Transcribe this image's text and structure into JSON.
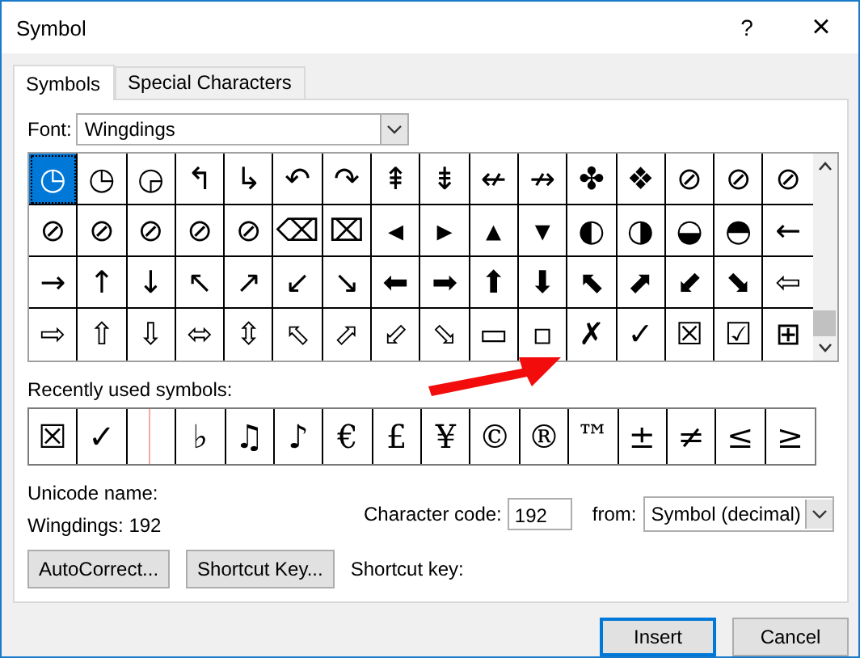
{
  "window": {
    "title": "Symbol",
    "help": "?",
    "close": "×"
  },
  "tabs": [
    {
      "label": "Symbols",
      "selected": true
    },
    {
      "label": "Special Characters",
      "selected": false
    }
  ],
  "font": {
    "label": "Font:",
    "value": "Wingdings"
  },
  "grid": [
    {
      "symbol": "◷",
      "selected": true
    },
    {
      "symbol": "◷",
      "selected": false
    },
    {
      "symbol": "◶",
      "selected": false
    },
    {
      "symbol": "↰",
      "selected": false
    },
    {
      "symbol": "↳",
      "selected": false
    },
    {
      "symbol": "↶",
      "selected": false
    },
    {
      "symbol": "↷",
      "selected": false
    },
    {
      "symbol": "⇞",
      "selected": false
    },
    {
      "symbol": "⇟",
      "selected": false
    },
    {
      "symbol": "↚",
      "selected": false
    },
    {
      "symbol": "↛",
      "selected": false
    },
    {
      "symbol": "✤",
      "selected": false
    },
    {
      "symbol": "❖",
      "selected": false
    },
    {
      "symbol": "⊘",
      "selected": false
    },
    {
      "symbol": "⊘",
      "selected": false
    },
    {
      "symbol": "⊘",
      "selected": false
    },
    {
      "symbol": "⊘",
      "selected": false
    },
    {
      "symbol": "⊘",
      "selected": false
    },
    {
      "symbol": "⊘",
      "selected": false
    },
    {
      "symbol": "⊘",
      "selected": false
    },
    {
      "symbol": "⊘",
      "selected": false
    },
    {
      "symbol": "⌫",
      "selected": false
    },
    {
      "symbol": "⌧",
      "selected": false
    },
    {
      "symbol": "◂",
      "selected": false
    },
    {
      "symbol": "▸",
      "selected": false
    },
    {
      "symbol": "▴",
      "selected": false
    },
    {
      "symbol": "▾",
      "selected": false
    },
    {
      "symbol": "◐",
      "selected": false
    },
    {
      "symbol": "◑",
      "selected": false
    },
    {
      "symbol": "◒",
      "selected": false
    },
    {
      "symbol": "◓",
      "selected": false
    },
    {
      "symbol": "←",
      "selected": false
    },
    {
      "symbol": "→",
      "selected": false
    },
    {
      "symbol": "↑",
      "selected": false
    },
    {
      "symbol": "↓",
      "selected": false
    },
    {
      "symbol": "↖",
      "selected": false
    },
    {
      "symbol": "↗",
      "selected": false
    },
    {
      "symbol": "↙",
      "selected": false
    },
    {
      "symbol": "↘",
      "selected": false
    },
    {
      "symbol": "⬅",
      "selected": false
    },
    {
      "symbol": "➡",
      "selected": false
    },
    {
      "symbol": "⬆",
      "selected": false
    },
    {
      "symbol": "⬇",
      "selected": false
    },
    {
      "symbol": "⬉",
      "selected": false
    },
    {
      "symbol": "⬈",
      "selected": false
    },
    {
      "symbol": "⬋",
      "selected": false
    },
    {
      "symbol": "⬊",
      "selected": false
    },
    {
      "symbol": "⇦",
      "selected": false
    },
    {
      "symbol": "⇨",
      "selected": false
    },
    {
      "symbol": "⇧",
      "selected": false
    },
    {
      "symbol": "⇩",
      "selected": false
    },
    {
      "symbol": "⬄",
      "selected": false
    },
    {
      "symbol": "⇳",
      "selected": false
    },
    {
      "symbol": "⬁",
      "selected": false
    },
    {
      "symbol": "⬀",
      "selected": false
    },
    {
      "symbol": "⬃",
      "selected": false
    },
    {
      "symbol": "⬂",
      "selected": false
    },
    {
      "symbol": "▭",
      "selected": false
    },
    {
      "symbol": "▫",
      "selected": false
    },
    {
      "symbol": "✗",
      "selected": false
    },
    {
      "symbol": "✓",
      "selected": false
    },
    {
      "symbol": "☒",
      "selected": false
    },
    {
      "symbol": "☑",
      "selected": false
    },
    {
      "symbol": "⊞",
      "selected": false
    }
  ],
  "recent": {
    "label": "Recently used symbols:",
    "items": [
      {
        "kind": "glyph",
        "symbol": "☒"
      },
      {
        "kind": "glyph",
        "symbol": "✓"
      },
      {
        "kind": "blank"
      },
      {
        "kind": "glyph",
        "symbol": "♭"
      },
      {
        "kind": "glyph",
        "symbol": "♫"
      },
      {
        "kind": "glyph",
        "symbol": "♪"
      },
      {
        "kind": "glyph",
        "symbol": "€"
      },
      {
        "kind": "glyph",
        "symbol": "£"
      },
      {
        "kind": "glyph",
        "symbol": "¥"
      },
      {
        "kind": "glyph",
        "symbol": "©"
      },
      {
        "kind": "glyph",
        "symbol": "®"
      },
      {
        "kind": "glyph",
        "symbol": "™"
      },
      {
        "kind": "glyph",
        "symbol": "±"
      },
      {
        "kind": "glyph",
        "symbol": "≠"
      },
      {
        "kind": "glyph",
        "symbol": "≤"
      },
      {
        "kind": "glyph",
        "symbol": "≥"
      }
    ]
  },
  "unicode_name": {
    "label": "Unicode name:",
    "value": "Wingdings: 192"
  },
  "character_code": {
    "label": "Character code:",
    "value": "192"
  },
  "from": {
    "label": "from:",
    "value": "Symbol (decimal)"
  },
  "autocorrect_button": "AutoCorrect...",
  "shortcut_key_button": "Shortcut Key...",
  "shortcut_key_label": "Shortcut key:",
  "buttons": [
    {
      "label": "Insert",
      "default": true
    },
    {
      "label": "Cancel",
      "default": false
    }
  ]
}
